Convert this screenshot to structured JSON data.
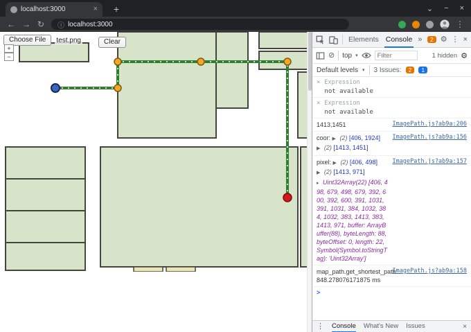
{
  "icons": {
    "back": "←",
    "forward": "→",
    "reload": "↻",
    "site_info": "ⓘ",
    "kebab": "⋮",
    "close": "×",
    "chevron_down": "⌄",
    "minimize": "−",
    "new_tab": "+",
    "more_tabs": "»",
    "dropdown": "▾",
    "clear_console": "⊘",
    "gear": "⚙",
    "expand": "▶",
    "expand_small": "▸",
    "prompt": ">",
    "zoom_in": "+",
    "zoom_out": "−",
    "remove": "×"
  },
  "browser": {
    "tab_title": "localhost:3000",
    "url": "localhost:3000"
  },
  "page": {
    "choose_file_label": "Choose File",
    "file_name": "test.png",
    "clear_label": "Clear"
  },
  "devtools": {
    "tab_elements": "Elements",
    "tab_console": "Console",
    "error_badge": "2",
    "context_selector": "top",
    "filter_placeholder": "Filter",
    "hidden_count": "1 hidden",
    "default_levels": "Default levels",
    "issues_label": "3 Issues:",
    "issue_badge_warn": "2",
    "issue_badge_info": "1",
    "expr1_label": "Expression",
    "expr1_value": "not available",
    "expr2_label": "Expression",
    "expr2_value": "not available",
    "log1_text": "1413,1451",
    "log1_source": "ImagePath.js?ab9a:206",
    "coor_label": "coor:",
    "coor_count1": "(2)",
    "coor_array1": "[406, 1924]",
    "coor_count2": "(2)",
    "coor_array2": "[1413, 1451]",
    "coor_source": "ImagePath.js?ab9a:156",
    "pixel_label": "pixel:",
    "pixel_count1": "(2)",
    "pixel_array1": "[406, 498]",
    "pixel_count2": "(2)",
    "pixel_array2": "[1413, 971]",
    "pixel_source": "ImagePath.js?ab9a:157",
    "pixel_expanded": "Uint32Array(22) [406, 498, 679, 498, 679, 392, 600, 392, 600, 391, 1031, 391, 1031, 384, 1032, 384, 1032, 383, 1413, 383, 1413, 971, buffer: ArrayBuffer(88), byteLength: 88, byteOffset: 0, length: 22, Symbol(Symbol.toStringTag): 'Uint32Array']",
    "timer_text": "map_path.get_shortest_path: 848.278076171875 ms",
    "timer_source": "ImagePath.js?ab9a:158",
    "drawer_console": "Console",
    "drawer_whats_new": "What's New",
    "drawer_issues": "Issues"
  }
}
